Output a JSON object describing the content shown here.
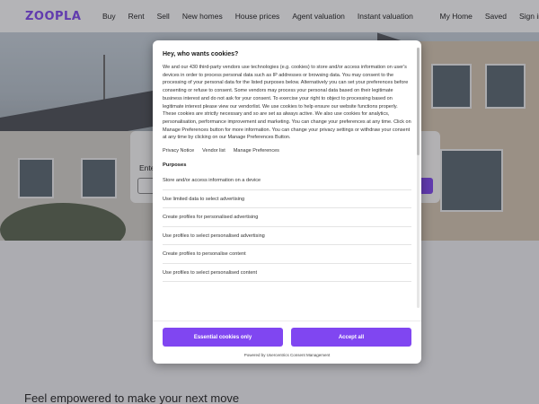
{
  "nav": {
    "logo": "ZOOPLA",
    "links": [
      "Buy",
      "Rent",
      "Sell",
      "New homes",
      "House prices",
      "Agent valuation",
      "Instant valuation"
    ],
    "right_links": [
      "My Home",
      "Saved",
      "Sign in"
    ]
  },
  "hero": {
    "search_label": "Enter"
  },
  "tagline": "Feel empowered to make your next move",
  "cookie_modal": {
    "title": "Hey, who wants cookies?",
    "body": "We and our 430 third-party vendors use technologies (e.g. cookies) to store and/or access information on user's devices in order to process personal data such as IP addresses or browsing data. You may consent to the processing of your personal data for the listed purposes below. Alternatively you can set your preferences before consenting or refuse to consent. Some vendors may process your personal data based on their legitimate business interest and do not ask for your consent. To exercise your right to object to processing based on legitimate interest please view our vendorlist. We use cookies to help ensure our website functions properly. These cookies are strictly necessary and so are set as always active. We also use cookies for analytics, personalisation, performance improvement and marketing. You can change your preferences at any time. Click on Manage Preferences button for more information. You can change your privacy settings or withdraw your consent at any time by clicking on our Manage Preferences Button.",
    "links": [
      "Privacy Notice",
      "Vendor list",
      "Manage Preferences"
    ],
    "purposes_heading": "Purposes",
    "purposes": [
      "Store and/or access information on a device",
      "Use limited data to select advertising",
      "Create profiles for personalised advertising",
      "Use profiles to select personalised advertising",
      "Create profiles to personalise content",
      "Use profiles to select personalised content"
    ],
    "essential_button": "Essential cookies only",
    "accept_button": "Accept all",
    "powered_by": "Powered by Usercentrics Consent Management"
  },
  "colors": {
    "brand_purple": "#8046f1"
  }
}
